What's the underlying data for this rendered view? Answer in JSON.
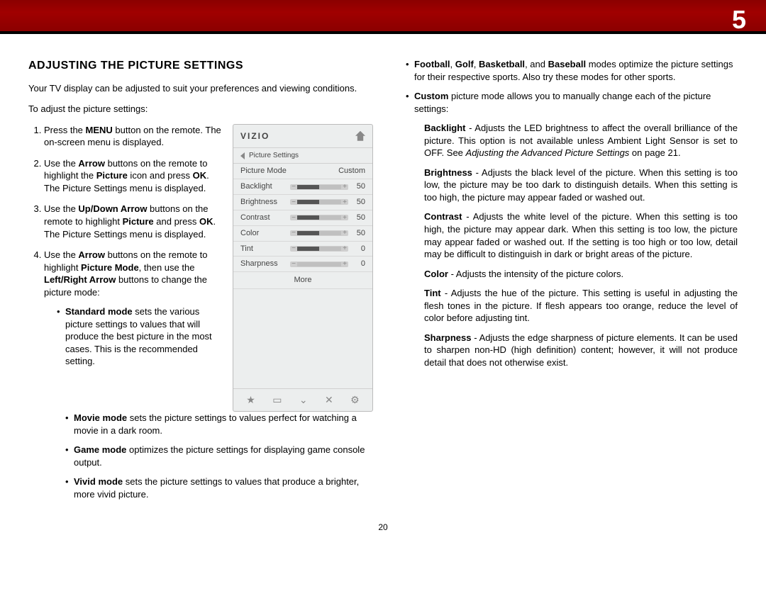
{
  "chapter": "5",
  "pageNumber": "20",
  "heading": "Adjusting the Picture Settings",
  "intro": "Your TV display can be adjusted to suit your preferences and viewing conditions.",
  "lead": "To adjust the picture settings:",
  "steps": {
    "1": {
      "pre": "Press the ",
      "b1": "MENU",
      "post": " button on the remote. The on-screen menu is displayed."
    },
    "2": {
      "pre": "Use the ",
      "b1": "Arrow",
      "mid": " buttons on the remote to highlight the ",
      "b2": "Picture",
      "post": " icon and press ",
      "b3": "OK",
      "post2": ". The Picture Settings menu is displayed."
    },
    "3": {
      "pre": "Use the ",
      "b1": "Up/Down Arrow",
      "mid": " buttons on the remote to highlight ",
      "b2": "Picture",
      "post": " and press ",
      "b3": "OK",
      "post2": ". The Picture Settings menu is displayed."
    },
    "4": {
      "pre": "Use the ",
      "b1": "Arrow",
      "mid": " buttons on the remote to highlight ",
      "b2": "Picture Mode",
      "post": ", then use the ",
      "b3": "Left/Right Arrow",
      "post2": " buttons to change the picture mode:"
    }
  },
  "modesLeft": {
    "standard": {
      "b": "Standard mode",
      "t": " sets the various picture settings to values that will produce the best picture in the most cases. This is the recommended setting."
    },
    "movie": {
      "b": "Movie mode",
      "t": " sets the picture settings to values perfect for watching a movie in a dark room."
    },
    "game": {
      "b": "Game mode",
      "t": " optimizes the picture settings for displaying game console output."
    },
    "vivid": {
      "b": "Vivid mode",
      "t": " sets the picture settings to values that produce a brighter, more vivid picture."
    }
  },
  "modesRight": {
    "sports": {
      "b1": "Football",
      "b2": "Golf",
      "b3": "Basketball",
      "b4": "Baseball",
      "t": " modes optimize the picture settings for their respective sports. Also try these modes for other sports."
    },
    "custom": {
      "b": "Custom",
      "t": " picture mode allows you to manually change each of the picture settings:"
    }
  },
  "defs": {
    "backlight": {
      "b": "Backlight",
      "t": " - Adjusts the LED brightness to affect the overall brilliance of the picture. This option is not available unless Ambient Light Sensor is set to OFF. See ",
      "i": "Adjusting the Advanced Picture Settings",
      "t2": " on page 21."
    },
    "brightness": {
      "b": "Brightness",
      "t": " - Adjusts the black level of the picture. When this setting is too low, the picture may be too dark to distinguish details. When this setting is too high, the picture may appear faded or washed out."
    },
    "contrast": {
      "b": "Contrast",
      "t": " - Adjusts the white level of the picture. When this setting is too high, the picture may appear dark. When this setting is too low, the picture may appear faded or washed out. If the setting is too high or too low, detail may be difficult to distinguish in dark or bright areas of the picture."
    },
    "color": {
      "b": "Color",
      "t": " - Adjusts the intensity of the picture colors."
    },
    "tint": {
      "b": "Tint",
      "t": " - Adjusts the hue of the picture. This setting is useful in adjusting the flesh tones in the picture. If flesh appears too orange, reduce the level of color before adjusting tint."
    },
    "sharpness": {
      "b": "Sharpness",
      "t": " - Adjusts the edge sharpness of picture elements. It can be used to sharpen non-HD (high definition) content; however, it will not produce detail that does not otherwise exist."
    }
  },
  "osd": {
    "brand": "VIZIO",
    "breadcrumb": "Picture Settings",
    "rows": [
      {
        "label": "Picture Mode",
        "value": "Custom",
        "isSelect": true
      },
      {
        "label": "Backlight",
        "value": "50",
        "fill": 50
      },
      {
        "label": "Brightness",
        "value": "50",
        "fill": 50
      },
      {
        "label": "Contrast",
        "value": "50",
        "fill": 50
      },
      {
        "label": "Color",
        "value": "50",
        "fill": 50
      },
      {
        "label": "Tint",
        "value": "0",
        "fill": 50
      },
      {
        "label": "Sharpness",
        "value": "0",
        "fill": 0
      }
    ],
    "more": "More",
    "footerIcons": [
      "★",
      "▭",
      "⌄",
      "✕",
      "⚙"
    ]
  }
}
